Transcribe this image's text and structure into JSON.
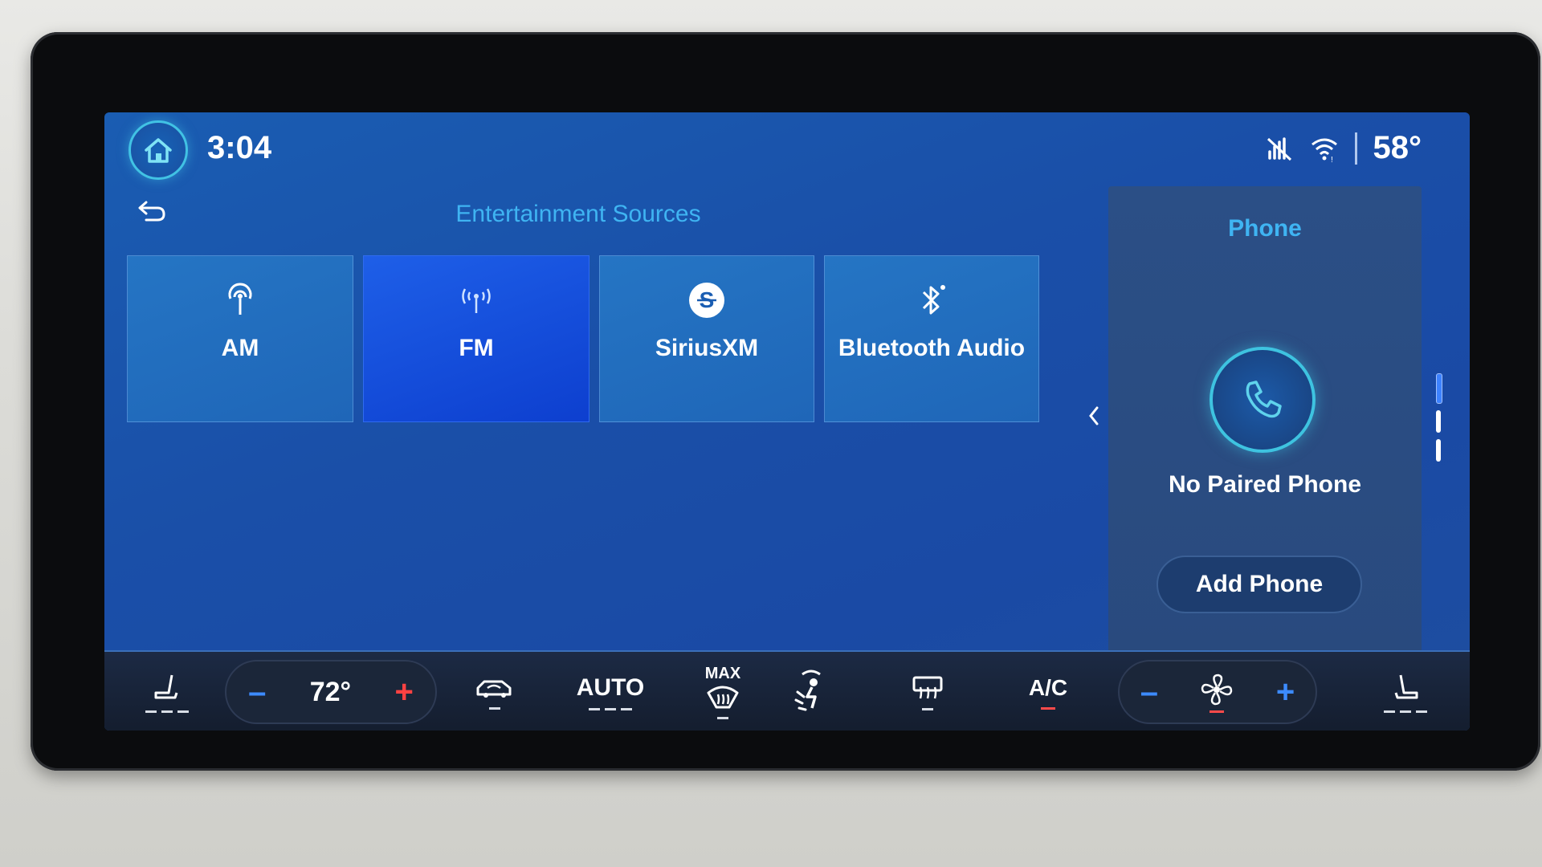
{
  "status": {
    "time": "3:04",
    "temperature": "58°"
  },
  "entertainment": {
    "title": "Entertainment Sources",
    "sources": [
      {
        "label": "AM",
        "icon": "am-antenna-icon",
        "active": false
      },
      {
        "label": "FM",
        "icon": "fm-antenna-icon",
        "active": true
      },
      {
        "label": "SiriusXM",
        "icon": "siriusxm-icon",
        "active": false
      },
      {
        "label": "Bluetooth Audio",
        "icon": "bluetooth-icon",
        "active": false
      }
    ]
  },
  "phone": {
    "title": "Phone",
    "status": "No Paired Phone",
    "add_label": "Add Phone"
  },
  "climate": {
    "driver_temp": "72°",
    "auto_label": "AUTO",
    "max_label": "MAX",
    "ac_label": "A/C"
  },
  "colors": {
    "accent": "#3fb4f2",
    "active_tile": "#1e5fe8",
    "screen_bg": "#1a4fa8",
    "minus": "#3c8bff",
    "plus": "#ff4242"
  }
}
